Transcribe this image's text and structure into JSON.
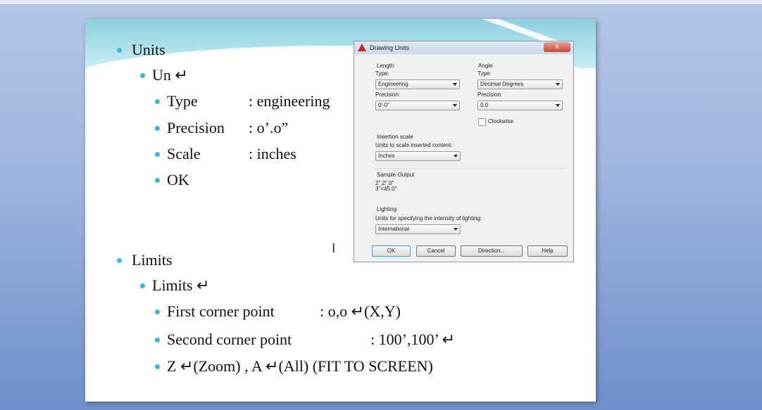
{
  "units": {
    "heading": "Units",
    "cmd": "Un ↵",
    "rows": [
      {
        "label": "Type",
        "value": ": engineering"
      },
      {
        "label": "Precision",
        "value": ": o’.o”"
      },
      {
        "label": "Scale",
        "value": ": inches"
      },
      {
        "label": "OK",
        "value": ""
      }
    ]
  },
  "limits": {
    "heading": "Limits",
    "cmd": "Limits ↵",
    "rows": [
      {
        "label": "First corner point",
        "value": ": o,o ↵(X,Y)"
      },
      {
        "label": "Second corner point",
        "value": ": 100’,100’ ↵"
      },
      {
        "label": "Z ↵(Zoom) , A ↵(All) (FIT TO SCREEN)",
        "value": ""
      }
    ]
  },
  "dialog": {
    "title": "Drawing Units",
    "close": "x",
    "length": "Length",
    "type_label": "Type:",
    "length_type": "Engineering",
    "precision_label": "Precision:",
    "length_precision": "0'-0\"",
    "angle": "Angle",
    "angle_type": "Decimal Degrees",
    "angle_precision": "0.0",
    "clockwise": "Clockwise",
    "insertion": "Insertion scale",
    "insertion_label": "Units to scale inserted content:",
    "insertion_value": "Inches",
    "sample": "Sample Output",
    "sample1": "2\",2\",0\"",
    "sample2": "3\"<45.0\"",
    "lighting": "Lighting",
    "lighting_label": "Units for specifying the intensity of lighting:",
    "lighting_value": "International",
    "ok": "OK",
    "cancel": "Cancel",
    "direction": "Direction...",
    "help": "Help"
  }
}
